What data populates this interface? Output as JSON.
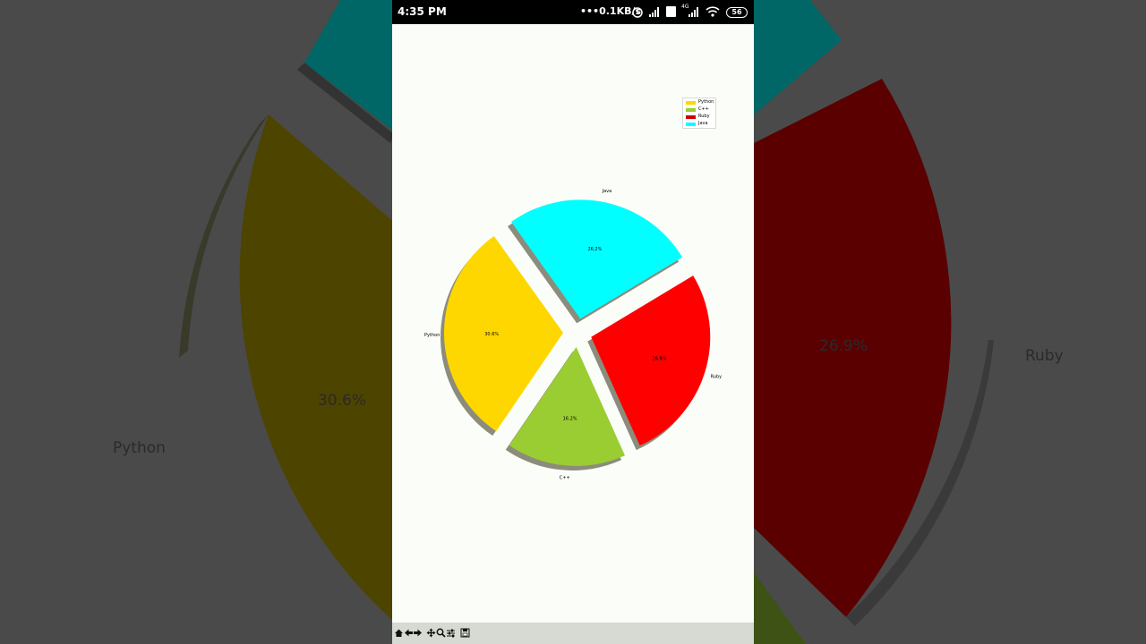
{
  "status_bar": {
    "time": "4:35 PM",
    "network_speed": "0.1KB/s",
    "network_type": "4G",
    "battery": "56"
  },
  "chart_data": {
    "type": "pie",
    "categories": [
      "Python",
      "C++",
      "Ruby",
      "Java"
    ],
    "values": [
      30.6,
      16.2,
      26.9,
      26.2
    ],
    "value_labels": [
      "30.6%",
      "16.2%",
      "26.9%",
      "26.2%"
    ],
    "colors": [
      "#ffd700",
      "#9acd32",
      "#ff0000",
      "#00ffff"
    ],
    "shadow": true,
    "exploded": true,
    "legend_position": "upper-right",
    "title": ""
  },
  "background": {
    "labels": [
      {
        "text": "Python"
      },
      {
        "text": "30.6%"
      },
      {
        "text": "26.9%"
      },
      {
        "text": "Ruby"
      }
    ]
  },
  "toolbar": {
    "icons": [
      "home-icon",
      "back-icon",
      "forward-icon",
      "pan-icon",
      "zoom-icon",
      "configure-icon",
      "save-icon"
    ]
  }
}
